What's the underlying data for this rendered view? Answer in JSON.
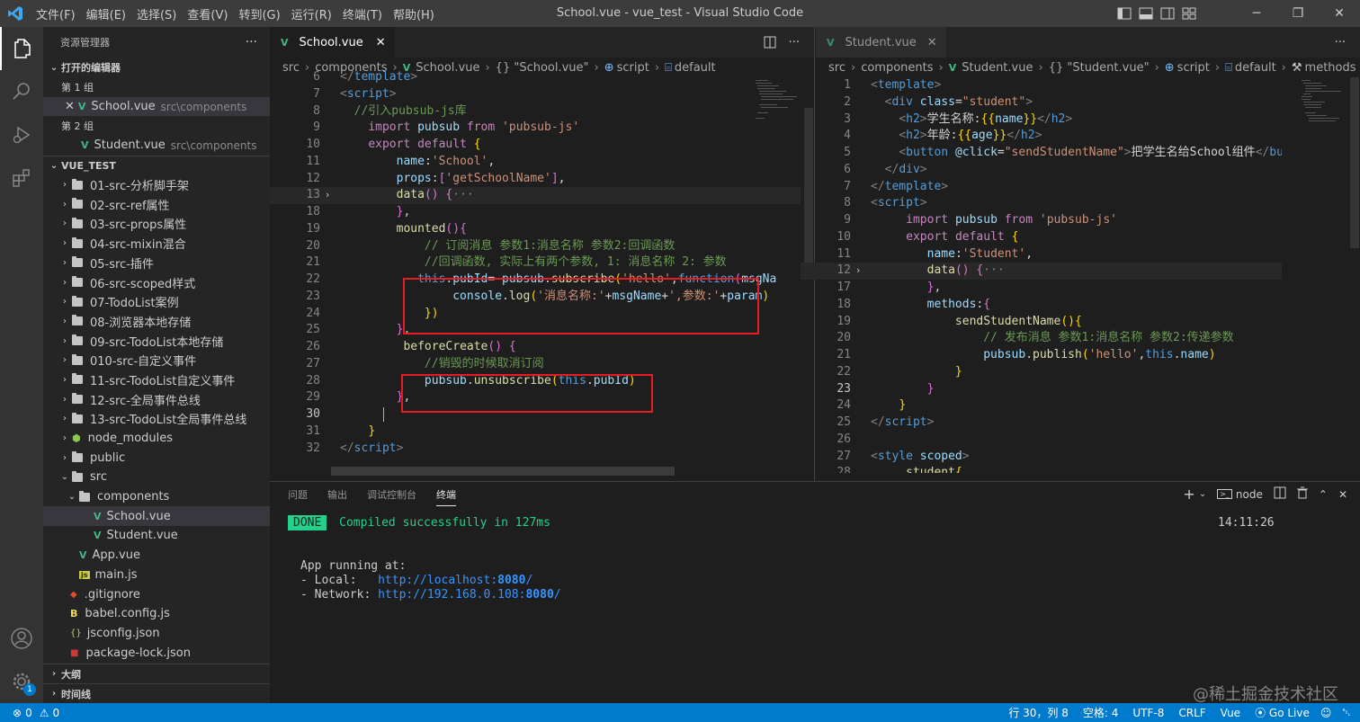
{
  "titlebar": {
    "title": "School.vue - vue_test - Visual Studio Code",
    "menu": [
      "文件(F)",
      "编辑(E)",
      "选择(S)",
      "查看(V)",
      "转到(G)",
      "运行(R)",
      "终端(T)",
      "帮助(H)"
    ]
  },
  "sidebar": {
    "title": "资源管理器",
    "open_editors": "打开的编辑器",
    "group1": "第 1 组",
    "group2": "第 2 组",
    "open1_name": "School.vue",
    "open1_path": "src\\components",
    "open2_name": "Student.vue",
    "open2_path": "src\\components",
    "project": "VUE_TEST",
    "folders": [
      "01-src-分析脚手架",
      "02-src-ref属性",
      "03-src-props属性",
      "04-src-mixin混合",
      "05-src-插件",
      "06-src-scoped样式",
      "07-TodoList案例",
      "08-浏览器本地存储",
      "09-src-TodoList本地存储",
      "010-src-自定义事件",
      "11-src-TodoList自定义事件",
      "12-src-全局事件总线",
      "13-src-TodoList全局事件总线",
      "node_modules",
      "public",
      "src"
    ],
    "components": "components",
    "comp_files": [
      "School.vue",
      "Student.vue"
    ],
    "src_files": [
      "App.vue",
      "main.js"
    ],
    "root_files": [
      ".gitignore",
      "babel.config.js",
      "jsconfig.json",
      "package-lock.json"
    ],
    "outline": "大纲",
    "timeline": "时间线"
  },
  "left_editor": {
    "tab": "School.vue",
    "breadcrumb": [
      "src",
      "components",
      "School.vue",
      "{} \"School.vue\"",
      "script",
      "default"
    ],
    "lines": [
      {
        "n": "6",
        "html": "<span class=\"gray\">&lt;/</span><span class=\"tag\">template</span><span class=\"gray\">&gt;</span>"
      },
      {
        "n": "7",
        "html": "<span class=\"gray\">&lt;</span><span class=\"tag\">script</span><span class=\"gray\">&gt;</span>"
      },
      {
        "n": "8",
        "html": "  <span class=\"cm\">//引入pubsub-js库</span>"
      },
      {
        "n": "9",
        "html": "    <span class=\"kw\">import</span> <span class=\"var\">pubsub</span> <span class=\"kw\">from</span> <span class=\"str\">'pubsub-js'</span>"
      },
      {
        "n": "10",
        "html": "    <span class=\"kw\">export</span> <span class=\"kw\">default</span> <span class=\"br\">{</span>"
      },
      {
        "n": "11",
        "html": "        <span class=\"var\">name</span>:<span class=\"str\">'School'</span>,"
      },
      {
        "n": "12",
        "html": "        <span class=\"var\">props</span>:<span class=\"lbr\">[</span><span class=\"str\">'getSchoolName'</span><span class=\"lbr\">]</span>,"
      },
      {
        "n": "13",
        "html": "        <span class=\"fn\">data</span><span class=\"lbr\">()</span> <span class=\"lbr\">{</span><span class=\"gray\">···</span>",
        "fold": true,
        "cur": true
      },
      {
        "n": "18",
        "html": "        <span class=\"lbr\">}</span>,"
      },
      {
        "n": "19",
        "html": "        <span class=\"fn\">mounted</span><span class=\"lbr\">(){</span>"
      },
      {
        "n": "20",
        "html": "            <span class=\"cm\">// 订阅消息 参数1:消息名称 参数2:回调函数</span>"
      },
      {
        "n": "21",
        "html": "            <span class=\"cm\">//回调函数, 实际上有两个参数, 1: 消息名称 2: 参数</span>"
      },
      {
        "n": "22",
        "html": "           <span class=\"kb\">this</span>.<span class=\"var\">pubId</span>= <span class=\"var\">pubsub</span>.<span class=\"fn\">subscribe</span><span class=\"br\">(</span><span class=\"str\">'hello'</span>,<span class=\"kb\">function</span><span class=\"lbr\">(</span><span class=\"var\">msgNa</span>"
      },
      {
        "n": "23",
        "html": "                <span class=\"var\">console</span>.<span class=\"fn\">log</span><span class=\"br\">(</span><span class=\"str\">'消息名称:'</span>+<span class=\"var\">msgName</span>+<span class=\"str\">',参数:'</span>+<span class=\"var\">param</span><span class=\"br\">)</span>"
      },
      {
        "n": "24",
        "html": "            <span class=\"br\">})</span>"
      },
      {
        "n": "25",
        "html": "        <span class=\"lbr\">}</span>,"
      },
      {
        "n": "26",
        "html": "         <span class=\"fn\">beforeCreate</span><span class=\"lbr\">()</span> <span class=\"lbr\">{</span>"
      },
      {
        "n": "27",
        "html": "            <span class=\"cm\">//销毁的时候取消订阅</span>"
      },
      {
        "n": "28",
        "html": "            <span class=\"var\">pubsub</span>.<span class=\"fn\">unsubscribe</span><span class=\"br\">(</span><span class=\"kb\">this</span>.<span class=\"var\">pubId</span><span class=\"br\">)</span>"
      },
      {
        "n": "29",
        "html": "        <span class=\"lbr\">}</span>,"
      },
      {
        "n": "30",
        "html": "",
        "cursor": true
      },
      {
        "n": "31",
        "html": "    <span class=\"br\">}</span>"
      },
      {
        "n": "32",
        "html": "<span class=\"gray\">&lt;/</span><span class=\"tag\">script</span><span class=\"gray\">&gt;</span>"
      }
    ]
  },
  "right_editor": {
    "tab": "Student.vue",
    "breadcrumb": [
      "src",
      "components",
      "Student.vue",
      "{} \"Student.vue\"",
      "script",
      "default",
      "methods"
    ],
    "lines": [
      {
        "n": "1",
        "html": "<span class=\"gray\">&lt;</span><span class=\"tag\">template</span><span class=\"gray\">&gt;</span>"
      },
      {
        "n": "2",
        "html": "  <span class=\"gray\">&lt;</span><span class=\"tag\">div</span> <span class=\"attr\">class</span>=<span class=\"str\">\"student\"</span><span class=\"gray\">&gt;</span>"
      },
      {
        "n": "3",
        "html": "    <span class=\"gray\">&lt;</span><span class=\"tag\">h2</span><span class=\"gray\">&gt;</span>学生名称:<span class=\"br\">{{</span><span class=\"var\">name</span><span class=\"br\">}}</span><span class=\"gray\">&lt;/</span><span class=\"tag\">h2</span><span class=\"gray\">&gt;</span>"
      },
      {
        "n": "4",
        "html": "    <span class=\"gray\">&lt;</span><span class=\"tag\">h2</span><span class=\"gray\">&gt;</span>年龄:<span class=\"br\">{{</span><span class=\"var\">age</span><span class=\"br\">}}</span><span class=\"gray\">&lt;/</span><span class=\"tag\">h2</span><span class=\"gray\">&gt;</span>"
      },
      {
        "n": "5",
        "html": "    <span class=\"gray\">&lt;</span><span class=\"tag\">button</span> <span class=\"attr\">@click</span>=<span class=\"str\">\"sendStudentName\"</span><span class=\"gray\">&gt;</span>把学生名给School组件<span class=\"gray\">&lt;/</span><span class=\"tag\">butt</span>"
      },
      {
        "n": "6",
        "html": "  <span class=\"gray\">&lt;/</span><span class=\"tag\">div</span><span class=\"gray\">&gt;</span>"
      },
      {
        "n": "7",
        "html": "<span class=\"gray\">&lt;/</span><span class=\"tag\">template</span><span class=\"gray\">&gt;</span>"
      },
      {
        "n": "8",
        "html": "<span class=\"gray\">&lt;</span><span class=\"tag\">script</span><span class=\"gray\">&gt;</span>"
      },
      {
        "n": "9",
        "html": "     <span class=\"kw\">import</span> <span class=\"var\">pubsub</span> <span class=\"kw\">from</span> <span class=\"str\">'pubsub-js'</span>"
      },
      {
        "n": "10",
        "html": "     <span class=\"kw\">export</span> <span class=\"kw\">default</span> <span class=\"br\">{</span>"
      },
      {
        "n": "11",
        "html": "        <span class=\"var\">name</span>:<span class=\"str\">'Student'</span>,"
      },
      {
        "n": "12",
        "html": "        <span class=\"fn\">data</span><span class=\"lbr\">()</span> <span class=\"lbr\">{</span><span class=\"gray\">···</span>",
        "fold": true,
        "cur": true
      },
      {
        "n": "17",
        "html": "        <span class=\"lbr\">}</span>,"
      },
      {
        "n": "18",
        "html": "        <span class=\"var\">methods</span>:<span class=\"lbr\">{</span>"
      },
      {
        "n": "19",
        "html": "            <span class=\"fn\">sendStudentName</span><span class=\"br\">(){</span>"
      },
      {
        "n": "20",
        "html": "                <span class=\"cm\">// 发布消息 参数1:消息名称 参数2:传递参数</span>"
      },
      {
        "n": "21",
        "html": "                <span class=\"var\">pubsub</span>.<span class=\"fn\">publish</span><span class=\"br\">(</span><span class=\"str\">'hello'</span>,<span class=\"kb\">this</span>.<span class=\"var\">name</span><span class=\"br\">)</span>"
      },
      {
        "n": "22",
        "html": "            <span class=\"br\">}</span>"
      },
      {
        "n": "23",
        "html": "        <span class=\"lbr\">}</span>",
        "curnum": true
      },
      {
        "n": "24",
        "html": "    <span class=\"br\">}</span>"
      },
      {
        "n": "25",
        "html": "<span class=\"gray\">&lt;/</span><span class=\"tag\">script</span><span class=\"gray\">&gt;</span>"
      },
      {
        "n": "26",
        "html": ""
      },
      {
        "n": "27",
        "html": "<span class=\"gray\">&lt;</span><span class=\"tag\">style</span> <span class=\"attr\">scoped</span><span class=\"gray\">&gt;</span>"
      },
      {
        "n": "28",
        "html": "    <span class=\"fn\">.student</span><span class=\"br\">{</span>"
      }
    ]
  },
  "panel": {
    "tabs": [
      "问题",
      "输出",
      "调试控制台",
      "终端"
    ],
    "shell": "node",
    "done_badge": "DONE",
    "compiled": "Compiled successfully in 127ms",
    "time": "14:11:26",
    "running": "App running at:",
    "local_label": "- Local:   ",
    "local_url_pre": "http://localhost:",
    "local_port": "8080",
    "network_label": "- Network: ",
    "network_url_pre": "http://192.168.0.108:",
    "network_port": "8080"
  },
  "statusbar": {
    "errors": "0",
    "warnings": "0",
    "position": "行 30，列 8",
    "spaces": "空格: 4",
    "encoding": "UTF-8",
    "eol": "CRLF",
    "lang": "Vue",
    "golive": "Go Live",
    "watermark": "@稀土掘金技术社区"
  },
  "colors": {
    "accent": "#007acc",
    "vue_green": "#41b883",
    "highlight_box": "#e51c23"
  }
}
